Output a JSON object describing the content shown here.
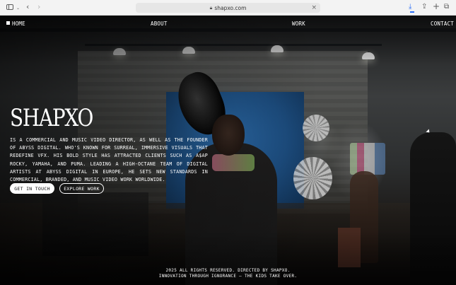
{
  "browser": {
    "url": "shapxo.com",
    "icons": [
      "sidebar-icon",
      "chevron-down-icon",
      "back-icon",
      "forward-icon",
      "lock-icon",
      "close-icon",
      "download-icon",
      "share-icon",
      "new-tab-icon",
      "tabs-icon"
    ]
  },
  "nav": {
    "home": "HOME",
    "about": "ABOUT",
    "work": "WORK",
    "contact": "CONTACT"
  },
  "hero": {
    "title": "SHAPXO",
    "description": "IS A COMMERCIAL AND MUSIC VIDEO DIRECTOR, AS WELL AS THE FOUNDER OF ABYSS DIGITAL. WHO'S KNOWN FOR SURREAL, IMMERSIVE VISUALS THAT REDEFINE VFX. HIS BOLD STYLE HAS ATTRACTED CLIENTS SUCH AS A$AP ROCKY, YAMAHA, AND PUMA. LEADING A HIGH-OCTANE TEAM OF DIGITAL ARTISTS AT ABYSS DIGITAL IN EUROPE, HE SETS NEW STANDARDS IN COMMERCIAL, BRANDED, AND MUSIC VIDEO WORK WORLDWIDE.",
    "primary_button": "GET IN TOUCH",
    "secondary_button": "EXPLORE WORK"
  },
  "footer": {
    "line1": "2025 ALL RIGHTS RESERVED. DIRECTED BY SHAPXO.",
    "line2": "INNOVATION THROUGH IGNORANCE — THE KIDS TAKE OVER."
  },
  "colors": {
    "chrome_bg": "#f3f3f3",
    "text": "#ffffff",
    "accent_download": "#2a6ef5"
  }
}
